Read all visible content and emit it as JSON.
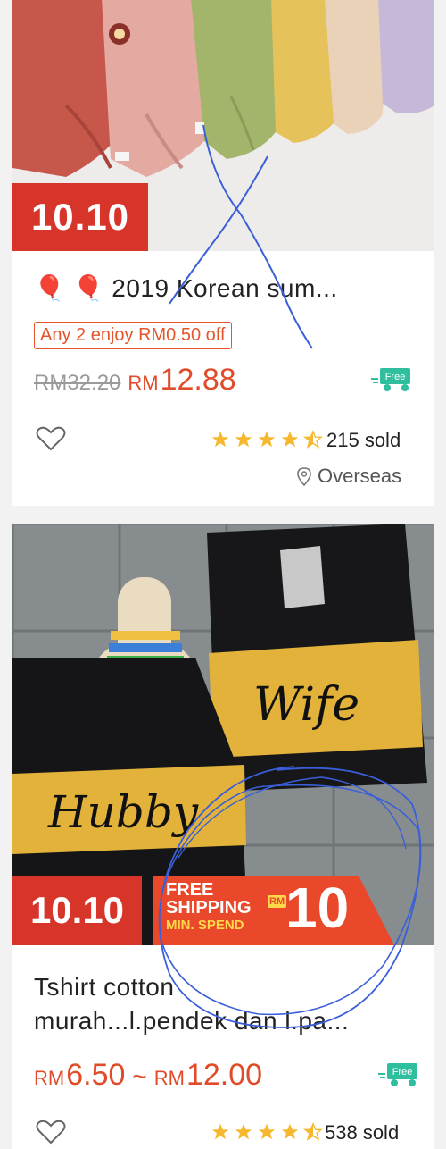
{
  "products": [
    {
      "sale_badge": "10.10",
      "title": "🎈 🎈 2019  Korean sum...",
      "promo": "Any 2 enjoy RM0.50 off",
      "original_price": "RM32.20",
      "currency": "RM",
      "price": "12.88",
      "free_label": "Free",
      "rating": 4.5,
      "sold": "215 sold",
      "location": "Overseas"
    },
    {
      "sale_badge": "10.10",
      "free_shipping": {
        "line1": "FREE",
        "line2": "SHIPPING",
        "line3": "MIN. SPEND",
        "currency": "RM",
        "amount": "10"
      },
      "title_line1": "Tshirt cotton",
      "title_line2": "murah...l.pendek dan l.pa...",
      "currency": "RM",
      "price_low": "6.50",
      "price_sep": "~",
      "price_high": "12.00",
      "free_label": "Free",
      "rating": 4.5,
      "sold": "538 sold"
    }
  ],
  "annotations": {
    "stroke_color": "#3a5fd8"
  },
  "colors": {
    "sale_red": "#d8352a",
    "price_orange": "#e04b2a",
    "free_green": "#2fbf9f"
  }
}
